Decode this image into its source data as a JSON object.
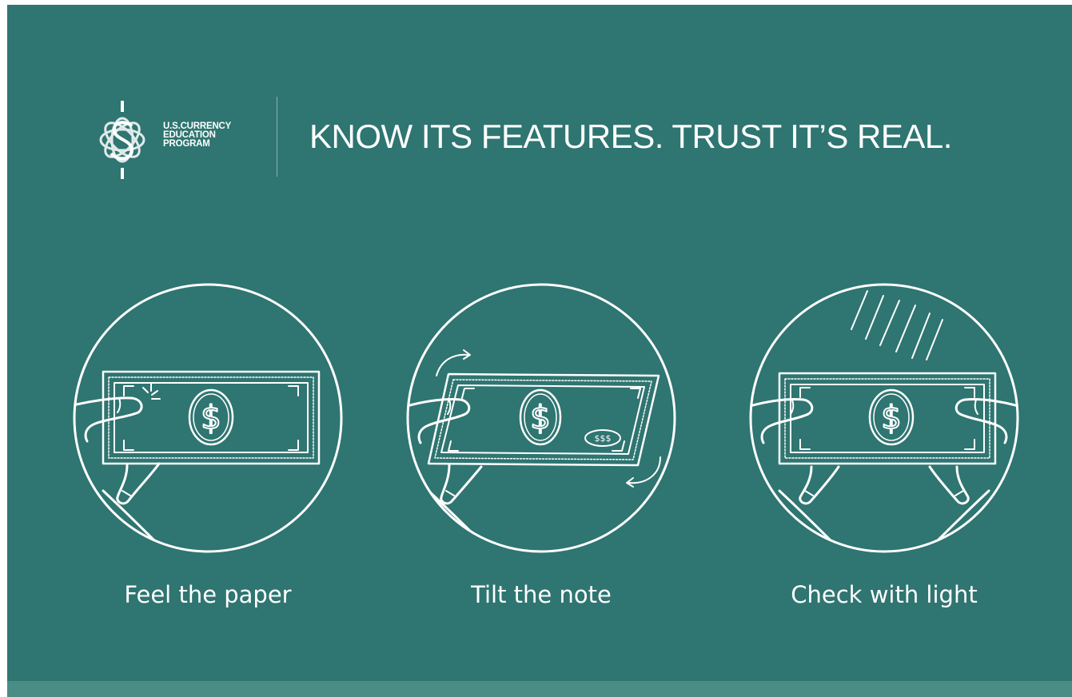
{
  "logo": {
    "icon": "currency-education-flower-logo",
    "lines": [
      "U.S.CURRENCY",
      "EDUCATION",
      "PROGRAM"
    ]
  },
  "headline": "KNOW ITS FEATURES. TRUST IT’S REAL.",
  "steps": [
    {
      "icon": "feel-paper-icon",
      "label": "Feel the paper"
    },
    {
      "icon": "tilt-note-icon",
      "label": "Tilt the note",
      "note_text": "$$$"
    },
    {
      "icon": "check-light-icon",
      "label": "Check with light"
    }
  ],
  "colors": {
    "background": "#2f7571",
    "footer_band": "#4a8c86",
    "foreground": "#ffffff"
  }
}
